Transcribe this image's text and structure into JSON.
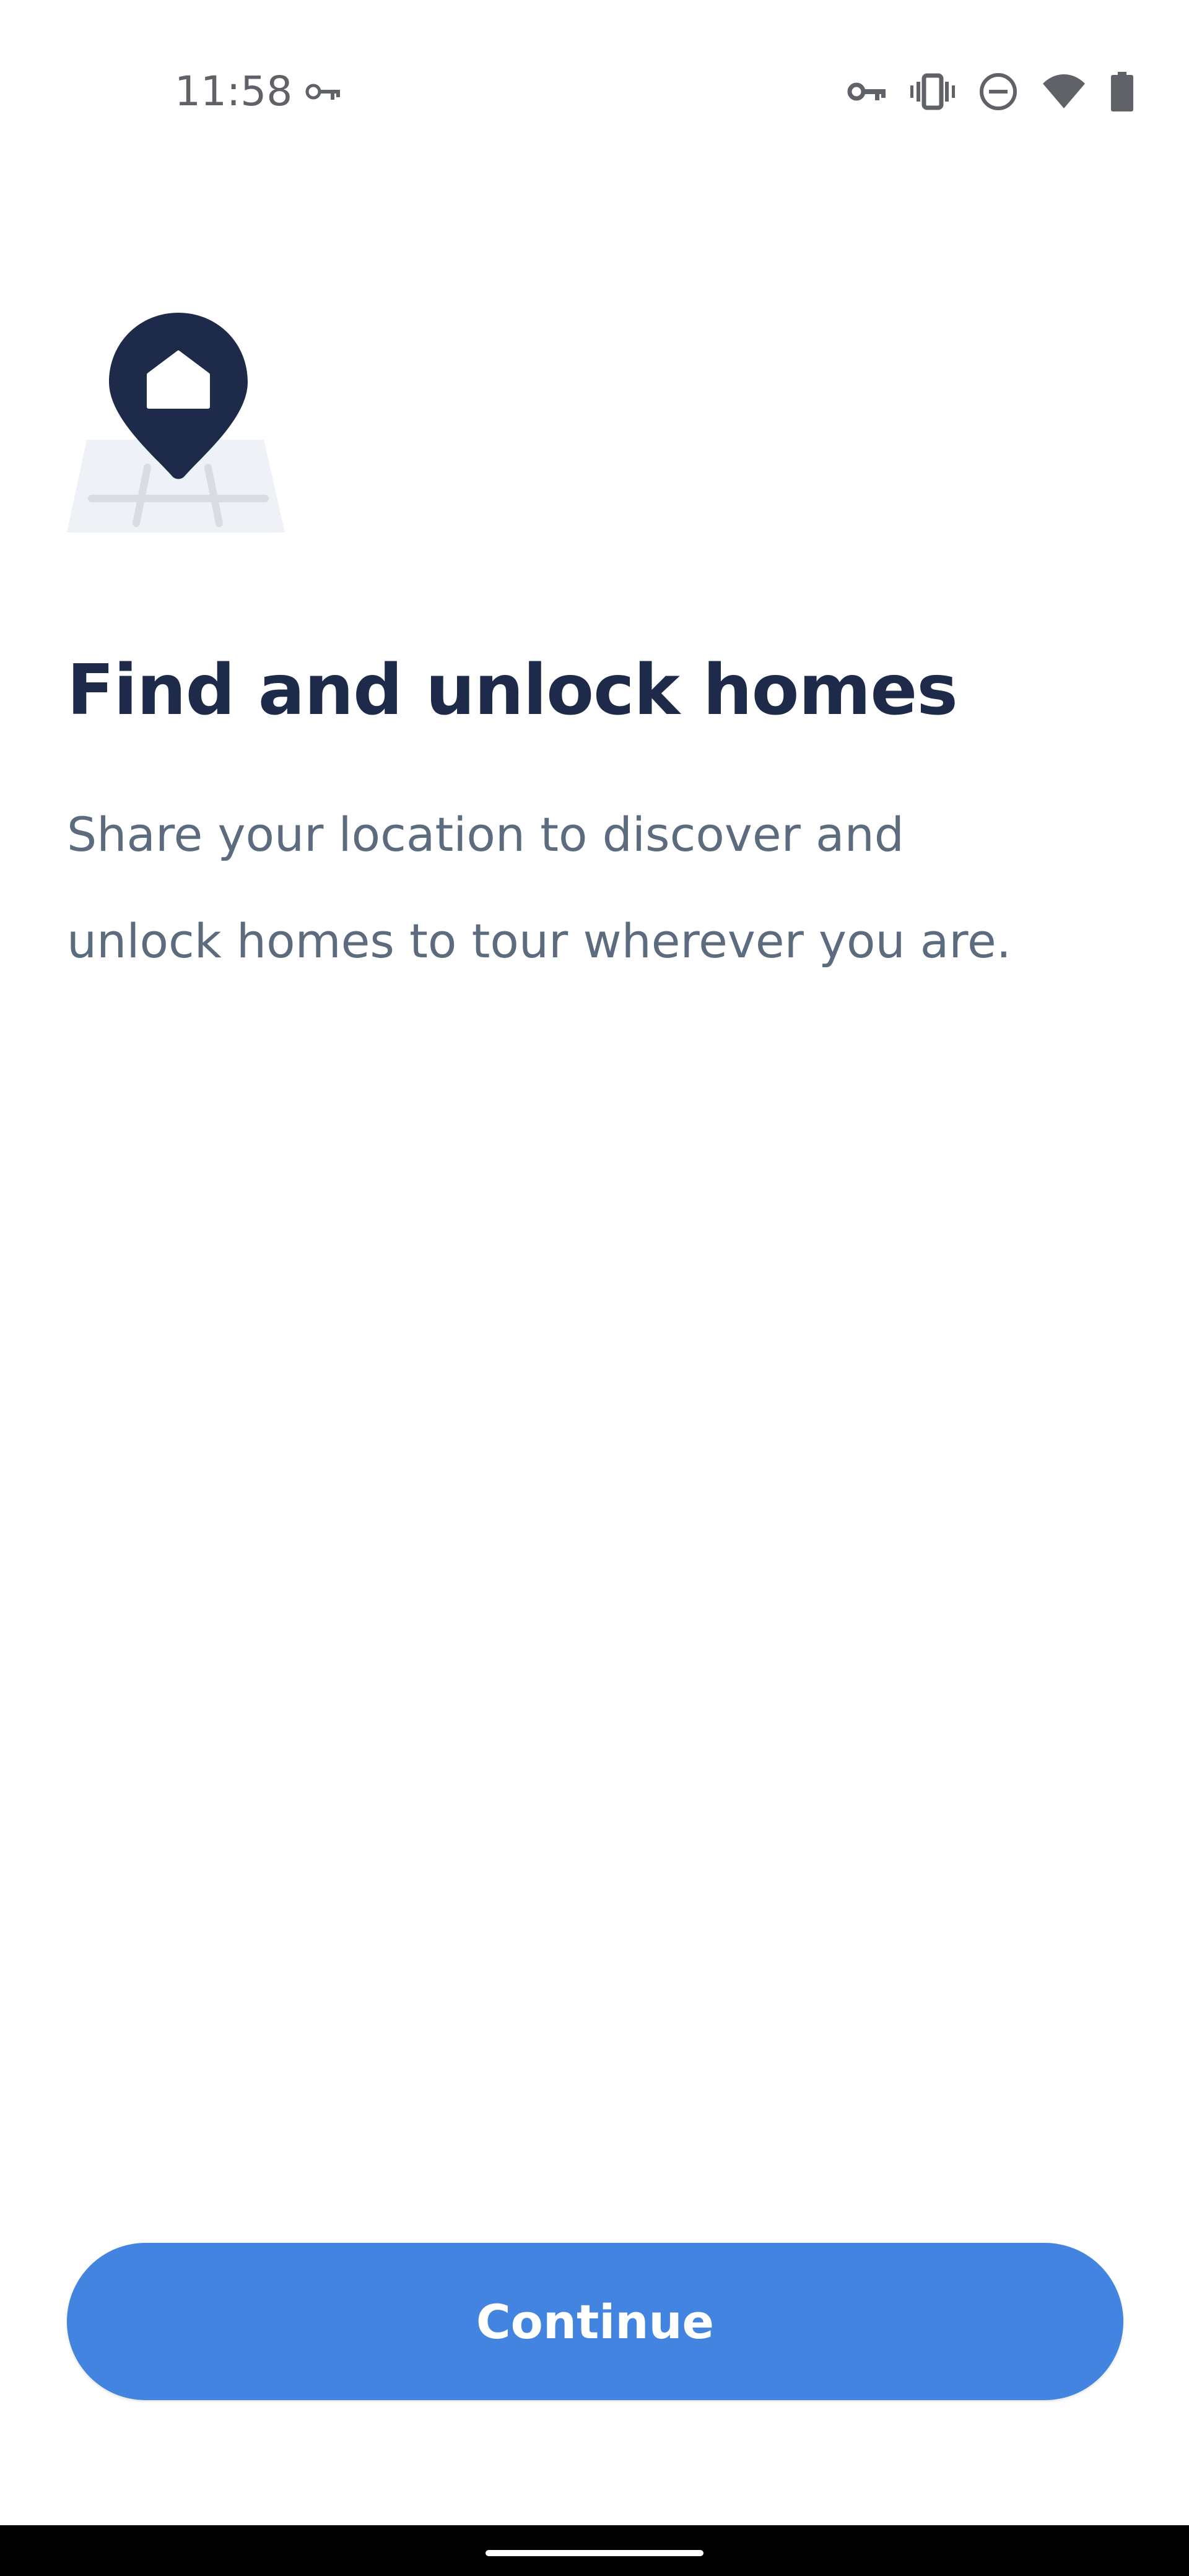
{
  "status_bar": {
    "time": "11:58",
    "left_icons": [
      "vpn-key-icon"
    ],
    "right_icons": [
      "vpn-key-icon",
      "vibrate-icon",
      "do-not-disturb-icon",
      "wifi-icon",
      "battery-icon"
    ]
  },
  "onboarding": {
    "illustration_icon": "location-pin-home-icon",
    "title": "Find and unlock homes",
    "description_line_1": "Share your location to discover and",
    "description_line_2": "unlock homes to tour wherever you are.",
    "continue_label": "Continue"
  },
  "colors": {
    "title": "#1d2a4a",
    "body_text": "#5c6b7d",
    "accent": "#4284e0",
    "pin": "#1d2a4a",
    "map": "#eef1f5"
  }
}
